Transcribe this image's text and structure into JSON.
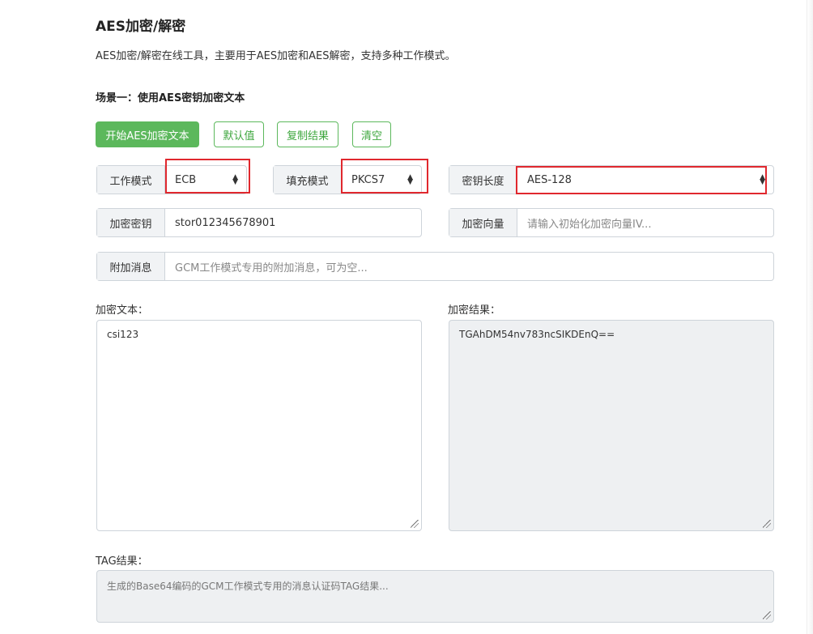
{
  "page": {
    "title": "AES加密/解密",
    "description": "AES加密/解密在线工具，主要用于AES加密和AES解密，支持多种工作模式。",
    "scene_title": "场景一：使用AES密钥加密文本"
  },
  "buttons": {
    "encrypt": "开始AES加密文本",
    "default": "默认值",
    "copy": "复制结果",
    "clear": "清空"
  },
  "options": {
    "mode_label": "工作模式",
    "mode_value": "ECB",
    "padding_label": "填充模式",
    "padding_value": "PKCS7",
    "keylen_label": "密钥长度",
    "keylen_value": "AES-128"
  },
  "key": {
    "label": "加密密钥",
    "value": "stor012345678901"
  },
  "iv": {
    "label": "加密向量",
    "placeholder": "请输入初始化加密向量IV..."
  },
  "aad": {
    "label": "附加消息",
    "placeholder": "GCM工作模式专用的附加消息，可为空..."
  },
  "plaintext": {
    "label": "加密文本：",
    "value": "csi123"
  },
  "result": {
    "label": "加密结果：",
    "value": "TGAhDM54nv783ncSIKDEnQ=="
  },
  "tag": {
    "label": "TAG结果：",
    "placeholder": "生成的Base64编码的GCM工作模式专用的消息认证码TAG结果..."
  },
  "colors": {
    "accent": "#5cb85c",
    "highlight": "#e0282e"
  }
}
